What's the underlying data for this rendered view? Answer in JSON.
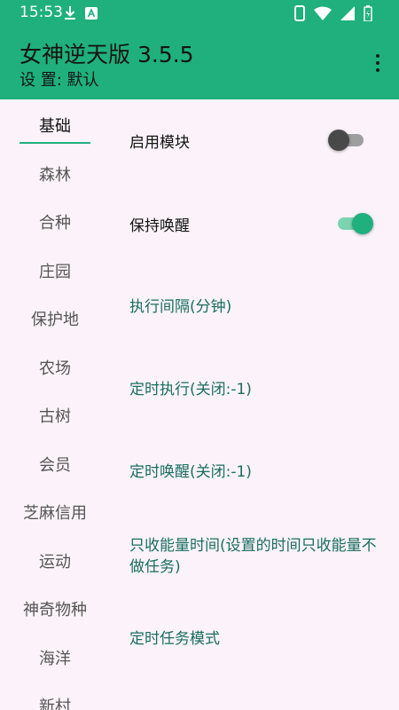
{
  "status_bar": {
    "time": "15:53",
    "background": "#1fb07e",
    "icons": [
      "download-icon",
      "a-badge-icon",
      "phone-icon",
      "wifi-icon",
      "signal-icon",
      "battery-charging-icon"
    ]
  },
  "app_bar": {
    "title": "女神逆天版 3.5.5",
    "subtitle": "设 置: 默认",
    "menu_icon": "more-vert-icon",
    "background": "#1fb07e"
  },
  "tabs": [
    {
      "label": "基础",
      "active": true
    },
    {
      "label": "森林",
      "active": false
    },
    {
      "label": "合种",
      "active": false
    },
    {
      "label": "庄园",
      "active": false
    },
    {
      "label": "保护地",
      "active": false
    },
    {
      "label": "农场",
      "active": false
    },
    {
      "label": "古树",
      "active": false
    },
    {
      "label": "会员",
      "active": false
    },
    {
      "label": "芝麻信用",
      "active": false
    },
    {
      "label": "运动",
      "active": false
    },
    {
      "label": "神奇物种",
      "active": false
    },
    {
      "label": "海洋",
      "active": false
    },
    {
      "label": "新村",
      "active": false
    }
  ],
  "settings": {
    "enable_module": {
      "label": "启用模块",
      "enabled": false
    },
    "keep_awake": {
      "label": "保持唤醒",
      "enabled": true
    },
    "exec_interval": {
      "label": "执行间隔(分钟)"
    },
    "timed_exec": {
      "label": "定时执行(关闭:-1)"
    },
    "timed_wake": {
      "label": "定时唤醒(关闭:-1)"
    },
    "collect_only_time": {
      "label": "只收能量时间(设置的时间只收能量不做任务)"
    },
    "timed_task_mode": {
      "label": "定时任务模式"
    }
  },
  "colors": {
    "accent": "#1fb07e",
    "link_text": "#1a6e60",
    "background": "#fbf3f9"
  }
}
